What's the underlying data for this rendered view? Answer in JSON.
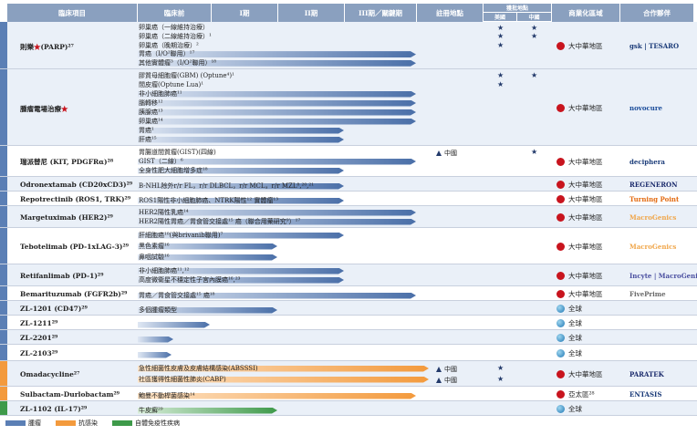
{
  "header": {
    "project": "臨床項目",
    "preclinical": "臨床前",
    "phase1": "I期",
    "phase2": "II期",
    "phase3": "III期／關鍵期",
    "registration": "註冊地點",
    "locations": "獲批地點",
    "us": "美國",
    "china": "中國",
    "territory": "商業化區域",
    "partner": "合作夥伴"
  },
  "colors": {
    "oncology": "#5b7fb5",
    "infection": "#f39a3d",
    "autoimmune": "#3e9a4a",
    "header": "#8aa0bf"
  },
  "programs": [
    {
      "name": "則樂",
      "name_star": "★",
      "name_suffix": "(PARP)²⁷",
      "indications": [
        "卵巢癌（一線維持治療）",
        "卵巢癌（二線維持治療）¹",
        "卵巢癌（晚期治療）²",
        "胃癌（I/O²聯用）¹⁷",
        "其他實體瘤³（I/O²聯用）¹⁸"
      ],
      "region": "大中華地區",
      "partner": "gsk | TESARO"
    },
    {
      "name": "腫瘤電場治療",
      "name_star": "★",
      "name_suffix": "",
      "indications": [
        "膠質母細胞瘤(GBM) (Optune⁴)¹",
        "間皮瘤(Optune Lua)¹",
        "非小細胞肺癌¹¹",
        "腦轉移¹²",
        "胰腺癌¹³",
        "卵巢癌¹⁴",
        "胃癌¹",
        "肝癌¹⁵"
      ],
      "region": "大中華地區",
      "partner": "novocure"
    },
    {
      "name": "瑞派替尼 (KIT, PDGFRα)²⁸",
      "indications": [
        "胃腸道間質瘤(GIST)(四線)",
        "GIST（二線）⁶",
        "全身性肥大細胞增多症¹⁸"
      ],
      "reg": "中國",
      "region": "大中華地區",
      "partner": "deciphera"
    },
    {
      "name": "Odronextamab (CD20xCD3)²⁹",
      "indications": [
        "B-NHL除外r/r FL，r/r DLBCL，r/r MCL，r/r MZL⁸,²⁰,²¹"
      ],
      "region": "大中華地區",
      "partner": "REGENERON"
    },
    {
      "name": "Repotrectinib (ROS1, TRK)²⁹",
      "indications": [
        "ROS1陽性非小細胞肺癌、NTRK陽性¹² 實體瘤¹³"
      ],
      "region": "大中華地區",
      "partner": "Turning Point"
    },
    {
      "name": "Margetuximab (HER2)²⁹",
      "indications": [
        "HER2陽性乳癌¹⁴",
        "HER2陽性胃癌／胃食管交接處¹⁵ 癌（聯合用藥研究⁹）¹⁷"
      ],
      "region": "大中華地區",
      "partner": "MacroGenics"
    },
    {
      "name": "Tebotelimab (PD-1xLAG-3)²⁹",
      "indications": [
        "肝細胞癌¹⁰(與brivanib聯用)⁷",
        "黑色素瘤¹⁶",
        "鼻咽試驗¹⁶"
      ],
      "region": "大中華地區",
      "partner": "MacroGenics"
    },
    {
      "name": "Retifanlimab (PD-1)²⁹",
      "indications": [
        "非小細胞肺癌¹¹,¹²",
        "高度微衛星不穩定性子宮內膜癌¹⁶,²³"
      ],
      "region": "大中華地區",
      "partner": "Incyte | MacroGenics"
    },
    {
      "name": "Bemarituzumab (FGFR2b)²⁹",
      "indications": [
        "胃癌／胃食管交接處¹⁵ 癌¹⁸"
      ],
      "region": "大中華地區",
      "partner": "FivePrime"
    },
    {
      "name": "ZL-1201 (CD47)²⁹",
      "indications": [
        "多個腫瘤類型"
      ],
      "region": "全球",
      "partner": ""
    },
    {
      "name": "ZL-1211²⁹",
      "indications": [
        ""
      ],
      "region": "全球",
      "partner": ""
    },
    {
      "name": "ZL-2201²⁹",
      "indications": [
        ""
      ],
      "region": "全球",
      "partner": ""
    },
    {
      "name": "ZL-2103²⁹",
      "indications": [
        ""
      ],
      "region": "全球",
      "partner": ""
    },
    {
      "name": "Omadacycline²⁷",
      "indications": [
        "急性細菌性皮膚及皮膚結構感染(ABSSSI)",
        "社區獲得性細菌性肺炎(CABP)"
      ],
      "reg": "中國",
      "region": "大中華地區",
      "partner": "PARATEK"
    },
    {
      "name": "Sulbactam-Durlobactam²⁹",
      "indications": [
        "鮑曼不動桿菌感染¹⁴"
      ],
      "region": "亞太區²⁸",
      "partner": "ENTASIS"
    },
    {
      "name": "ZL-1102 (IL-17)²⁹",
      "indications": [
        "牛皮癬²⁹"
      ],
      "region": "全球",
      "partner": ""
    }
  ],
  "legend": {
    "oncology": "腫瘤",
    "infection": "抗感染",
    "autoimmune": "自體免疫性疾病"
  }
}
